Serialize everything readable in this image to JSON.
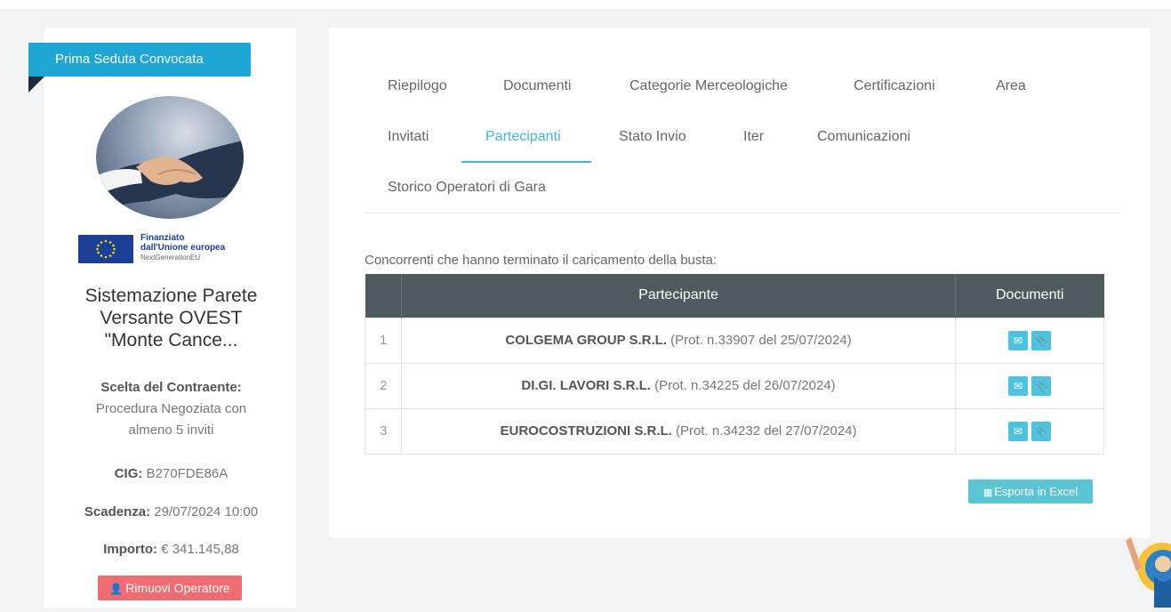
{
  "status_ribbon": "Prima Seduta Convocata",
  "eu_logo": {
    "line1": "Finanziato",
    "line2": "dall'Unione europea",
    "line3": "NextGenerationEU"
  },
  "tender": {
    "title_lines": [
      "Sistemazione Parete",
      "Versante OVEST",
      "\"Monte Cance..."
    ],
    "scelta_label": "Scelta del Contraente:",
    "scelta_value_1": "Procedura Negoziata con",
    "scelta_value_2": "almeno 5 inviti",
    "cig_label": "CIG:",
    "cig_value": " B270FDE86A",
    "scadenza_label": "Scadenza:",
    "scadenza_value": " 29/07/2024 10:00",
    "importo_label": "Importo:",
    "importo_value": " € 341.145,88",
    "remove_button": "Rimuovi Operatore"
  },
  "tabs": {
    "riepilogo": "Riepilogo",
    "documenti": "Documenti",
    "categorie": "Categorie Merceologiche",
    "certificazioni": "Certificazioni",
    "area": "Area",
    "invitati": "Invitati",
    "partecipanti": "Partecipanti",
    "stato_invio": "Stato Invio",
    "iter": "Iter",
    "comunicazioni": "Comunicazioni",
    "storico": "Storico Operatori di Gara"
  },
  "caption": "Concorrenti che hanno terminato il caricamento della busta:",
  "table": {
    "headers": [
      "",
      "Partecipante",
      "Documenti"
    ],
    "rows": [
      {
        "num": "1",
        "name": "COLGEMA GROUP S.R.L.",
        "prot": " (Prot. n.33907 del 25/07/2024)"
      },
      {
        "num": "2",
        "name": "DI.GI. LAVORI S.R.L.",
        "prot": " (Prot. n.34225 del 26/07/2024)"
      },
      {
        "num": "3",
        "name": "EUROCOSTRUZIONI S.R.L.",
        "prot": " (Prot. n.34232 del 27/07/2024)"
      }
    ]
  },
  "export_button": "Esporta in Excel",
  "colors": {
    "accent": "#3fb7d7",
    "ribbon": "#1ea6d5",
    "danger": "#ef6c73",
    "table_header": "#4d5a5e"
  }
}
